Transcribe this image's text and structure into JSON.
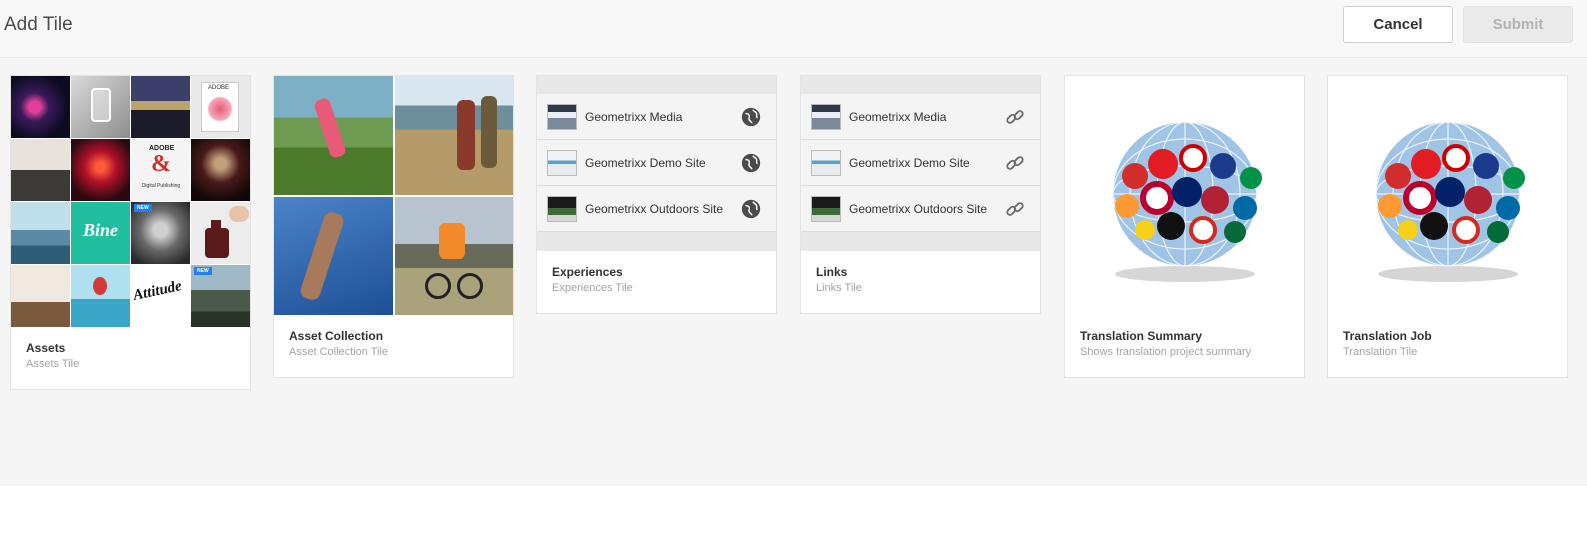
{
  "header": {
    "title": "Add Tile",
    "cancel_label": "Cancel",
    "submit_label": "Submit"
  },
  "tiles": [
    {
      "title": "Assets",
      "subtitle": "Assets Tile",
      "thumb_labels": {
        "bine": "Bine",
        "attitude": "Attitude",
        "adobe": "ADOBE",
        "amp": "&",
        "digital": "Digital Publishing",
        "new": "NEW"
      }
    },
    {
      "title": "Asset Collection",
      "subtitle": "Asset Collection Tile"
    },
    {
      "title": "Experiences",
      "subtitle": "Experiences Tile",
      "items": [
        "Geometrixx Media",
        "Geometrixx Demo Site",
        "Geometrixx Outdoors Site"
      ],
      "item_icon": "globe-icon"
    },
    {
      "title": "Links",
      "subtitle": "Links Tile",
      "items": [
        "Geometrixx Media",
        "Geometrixx Demo Site",
        "Geometrixx Outdoors Site"
      ],
      "item_icon": "link-icon"
    },
    {
      "title": "Translation Summary",
      "subtitle": "Shows translation project summary"
    },
    {
      "title": "Translation Job",
      "subtitle": "Translation Tile"
    }
  ],
  "colors": {
    "bine_tile": "#1fbfa0",
    "new_badge": "#2680eb",
    "disabled_text": "#b3b3b3"
  }
}
